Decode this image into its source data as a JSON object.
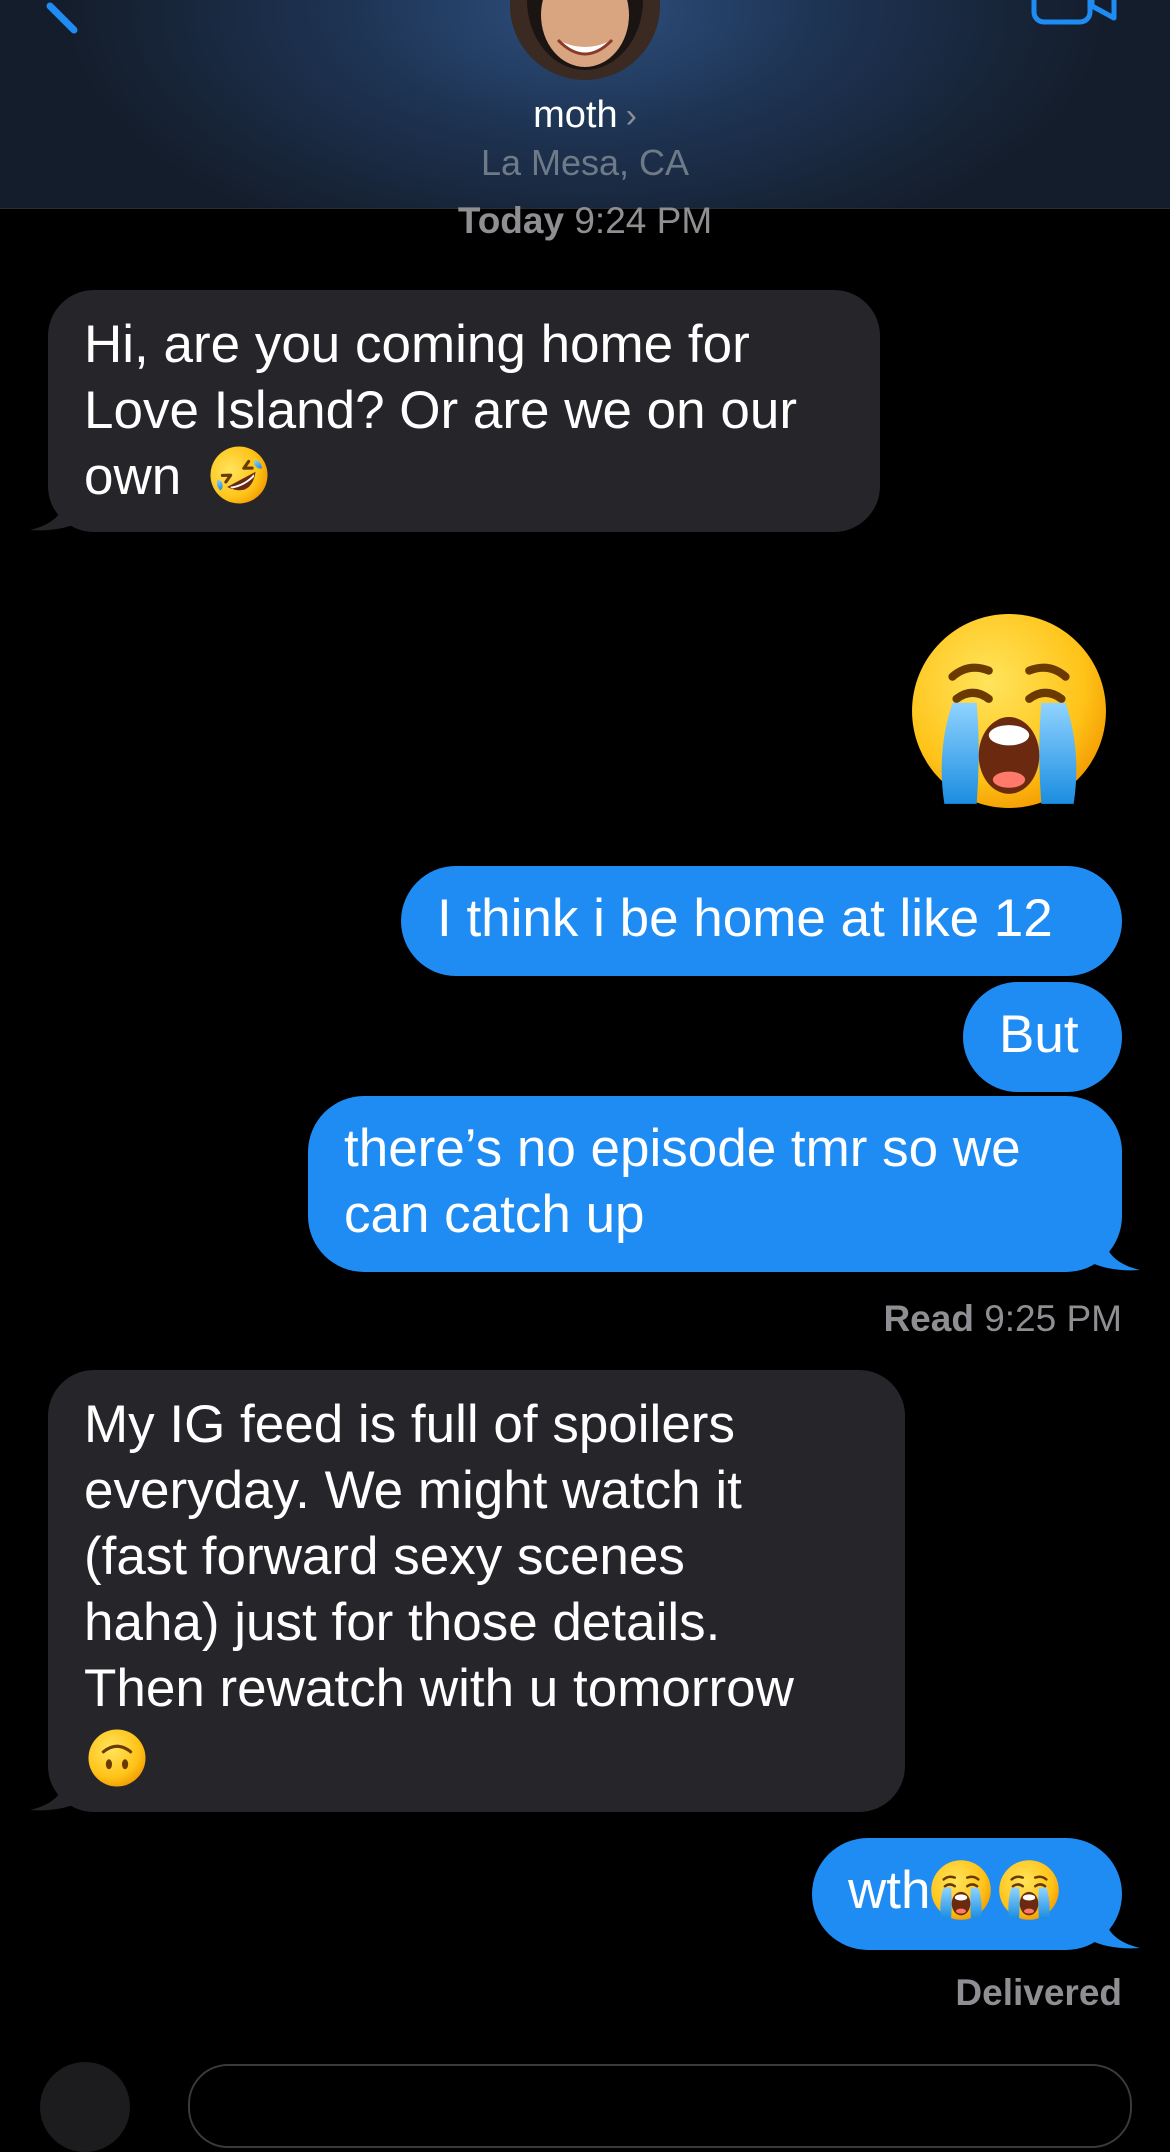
{
  "header": {
    "contact_name": "moth",
    "chevron": "›",
    "location": "La Mesa, CA",
    "icons": {
      "back": "chevron-left-icon",
      "facetime": "video-camera-icon",
      "avatar": "contact-avatar"
    }
  },
  "conversation": {
    "timestamp": {
      "day": "Today",
      "time": "9:24 PM"
    },
    "messages": [
      {
        "direction": "incoming",
        "lines": [
          "Hi, are you coming home for",
          "Love Island? Or are we on our",
          "own"
        ],
        "emoji": "rolling-on-floor-laughing-emoji"
      },
      {
        "direction": "outgoing",
        "big_emoji": "loudly-crying-face-emoji"
      },
      {
        "direction": "outgoing",
        "text": "I think i be home at like 12"
      },
      {
        "direction": "outgoing",
        "text": "But"
      },
      {
        "direction": "outgoing",
        "lines": [
          "there’s no episode tmr so we",
          "can catch up"
        ]
      },
      {
        "direction": "incoming",
        "lines": [
          "My IG feed is full of spoilers",
          "everyday. We might watch it",
          "(fast forward sexy scenes",
          "haha) just for those details.",
          "Then rewatch with u tomorrow"
        ],
        "emoji": "upside-down-face-emoji"
      },
      {
        "direction": "outgoing",
        "text": "wth",
        "emojis": [
          "loudly-crying-face-emoji",
          "loudly-crying-face-emoji"
        ]
      }
    ],
    "read_receipt": {
      "label": "Read",
      "time": "9:25 PM"
    },
    "delivered": "Delivered"
  },
  "colors": {
    "background": "#000000",
    "incoming_bubble": "#26252a",
    "outgoing_bubble": "#1f8cf4",
    "secondary_text": "#8e8e93",
    "accent": "#1f8cf4"
  }
}
